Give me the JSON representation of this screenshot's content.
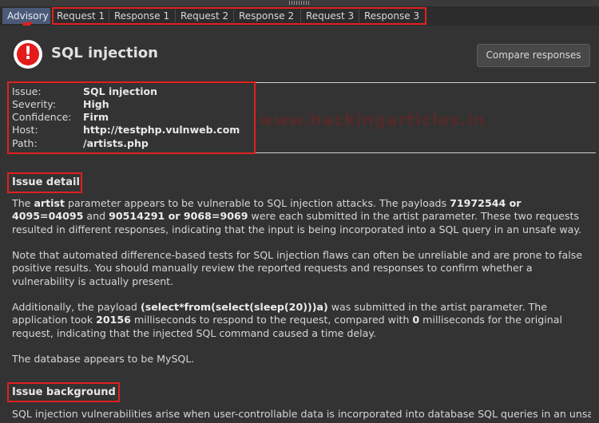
{
  "tabs": [
    {
      "label": "Advisory",
      "active": true
    },
    {
      "label": "Request 1"
    },
    {
      "label": "Response 1"
    },
    {
      "label": "Request 2"
    },
    {
      "label": "Response 2"
    },
    {
      "label": "Request 3"
    },
    {
      "label": "Response 3"
    }
  ],
  "issue_title": "SQL injection",
  "compare_button": "Compare responses",
  "watermark": "www.hackingarticles.in",
  "properties": [
    {
      "key": "Issue:",
      "value": "SQL injection"
    },
    {
      "key": "Severity:",
      "value": "High"
    },
    {
      "key": "Confidence:",
      "value": "Firm"
    },
    {
      "key": "Host:",
      "value": "http://testphp.vulnweb.com"
    },
    {
      "key": "Path:",
      "value": "/artists.php"
    }
  ],
  "issue_detail": {
    "heading": "Issue detail",
    "p1": {
      "a": "The ",
      "b1": "artist",
      "c": " parameter appears to be vulnerable to SQL injection attacks. The payloads ",
      "b2": "71972544 or 4095=04095",
      "d": " and ",
      "b3": "90514291 or 9068=9069",
      "e": " were each submitted in the artist parameter. These two requests resulted in different responses, indicating that the input is being incorporated into a SQL query in an unsafe way."
    },
    "p2": "Note that automated difference-based tests for SQL injection flaws can often be unreliable and are prone to false positive results. You should manually review the reported requests and responses to confirm whether a vulnerability is actually present.",
    "p3": {
      "a": "Additionally, the payload ",
      "b1": "(select*from(select(sleep(20)))a)",
      "c": " was submitted in the artist parameter. The application took ",
      "b2": "20156",
      "d": " milliseconds to respond to the request, compared with ",
      "b3": "0",
      "e": " milliseconds for the original request, indicating that the injected SQL command caused a time delay."
    },
    "p4": "The database appears to be MySQL."
  },
  "issue_background": {
    "heading": "Issue background",
    "p1": "SQL injection vulnerabilities arise when user-controllable data is incorporated into database SQL queries in an unsafe"
  },
  "colors": {
    "background": "#323232",
    "active_tab": "#4b5a78",
    "annotation": "#e02020",
    "alert": "#e41b1b"
  }
}
